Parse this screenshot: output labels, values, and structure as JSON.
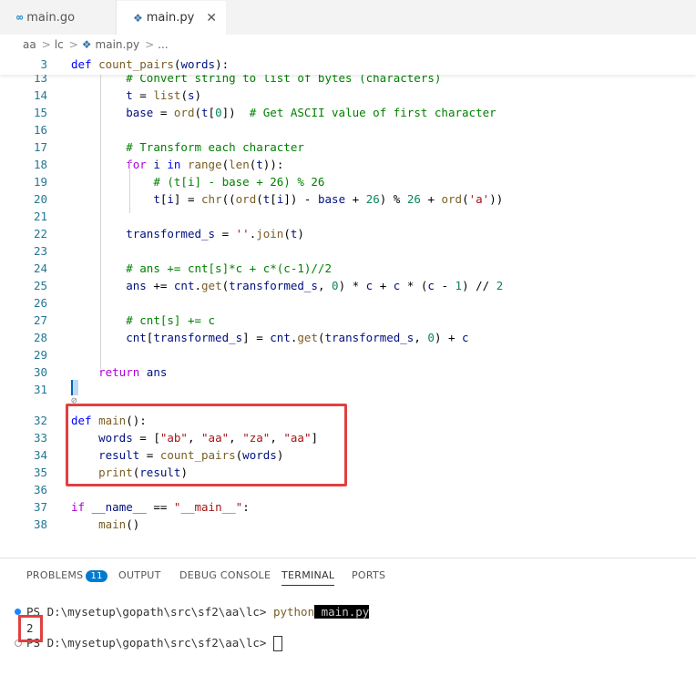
{
  "tabs": [
    {
      "label": "main.go",
      "icon": "go-icon",
      "active": false
    },
    {
      "label": "main.py",
      "icon": "python-icon",
      "active": true,
      "close": "✕"
    }
  ],
  "breadcrumb": [
    "aa",
    "lc",
    "main.py",
    "..."
  ],
  "editor": {
    "sticky": {
      "num": "3",
      "code": "def count_pairs(words):"
    },
    "lines": [
      {
        "num": "13",
        "code": "        # Convert string to list of bytes (characters)"
      },
      {
        "num": "14",
        "code": "        t = list(s)"
      },
      {
        "num": "15",
        "code": "        base = ord(t[0])  # Get ASCII value of first character"
      },
      {
        "num": "16",
        "code": ""
      },
      {
        "num": "17",
        "code": "        # Transform each character"
      },
      {
        "num": "18",
        "code": "        for i in range(len(t)):"
      },
      {
        "num": "19",
        "code": "            # (t[i] - base + 26) % 26"
      },
      {
        "num": "20",
        "code": "            t[i] = chr((ord(t[i]) - base + 26) % 26 + ord('a'))"
      },
      {
        "num": "21",
        "code": ""
      },
      {
        "num": "22",
        "code": "        transformed_s = ''.join(t)"
      },
      {
        "num": "23",
        "code": ""
      },
      {
        "num": "24",
        "code": "        # ans += cnt[s]*c + c*(c-1)//2"
      },
      {
        "num": "25",
        "code": "        ans += cnt.get(transformed_s, 0) * c + c * (c - 1) // 2"
      },
      {
        "num": "26",
        "code": ""
      },
      {
        "num": "27",
        "code": "        # cnt[s] += c"
      },
      {
        "num": "28",
        "code": "        cnt[transformed_s] = cnt.get(transformed_s, 0) + c"
      },
      {
        "num": "29",
        "code": ""
      },
      {
        "num": "30",
        "code": "    return ans"
      },
      {
        "num": "31",
        "code": ""
      },
      {
        "num": "32",
        "code": "def main():"
      },
      {
        "num": "33",
        "code": "    words = [\"ab\", \"aa\", \"za\", \"aa\"]"
      },
      {
        "num": "34",
        "code": "    result = count_pairs(words)"
      },
      {
        "num": "35",
        "code": "    print(result)"
      },
      {
        "num": "36",
        "code": ""
      },
      {
        "num": "37",
        "code": "if __name__ == \"__main__\":"
      },
      {
        "num": "38",
        "code": "    main()"
      }
    ]
  },
  "panel": {
    "tabs": [
      "PROBLEMS",
      "OUTPUT",
      "DEBUG CONSOLE",
      "TERMINAL",
      "PORTS"
    ],
    "problems_count": "11",
    "active_tab": "TERMINAL",
    "terminal": {
      "prompt1": "PS D:\\mysetup\\gopath\\src\\sf2\\aa\\lc> ",
      "command": "python",
      "arg": " main.py",
      "output": "2",
      "prompt2": "PS D:\\mysetup\\gopath\\src\\sf2\\aa\\lc> "
    }
  },
  "colors": {
    "highlight": "#e04040",
    "accent": "#007acc"
  }
}
